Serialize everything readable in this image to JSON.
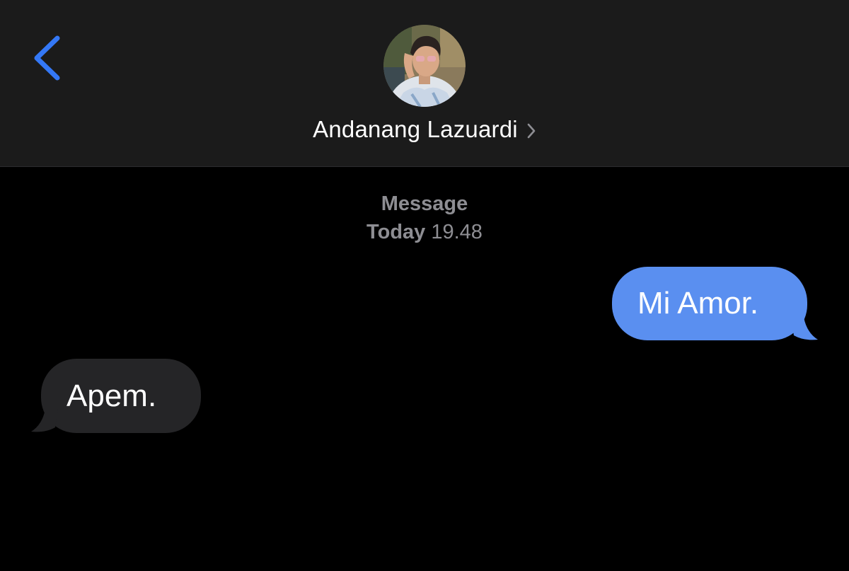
{
  "header": {
    "back_icon": "chevron-left-icon",
    "contact_name": "Andanang Lazuardi",
    "chevron_icon": "chevron-right-icon",
    "accent_color": "#3478f6"
  },
  "conversation": {
    "service_label": "Message",
    "timestamp_day": "Today",
    "timestamp_time": "19.48",
    "messages": [
      {
        "direction": "sent",
        "text": "Mi Amor.",
        "color": "#5a8ff0"
      },
      {
        "direction": "received",
        "text": "Apem.",
        "color": "#252527"
      }
    ]
  }
}
